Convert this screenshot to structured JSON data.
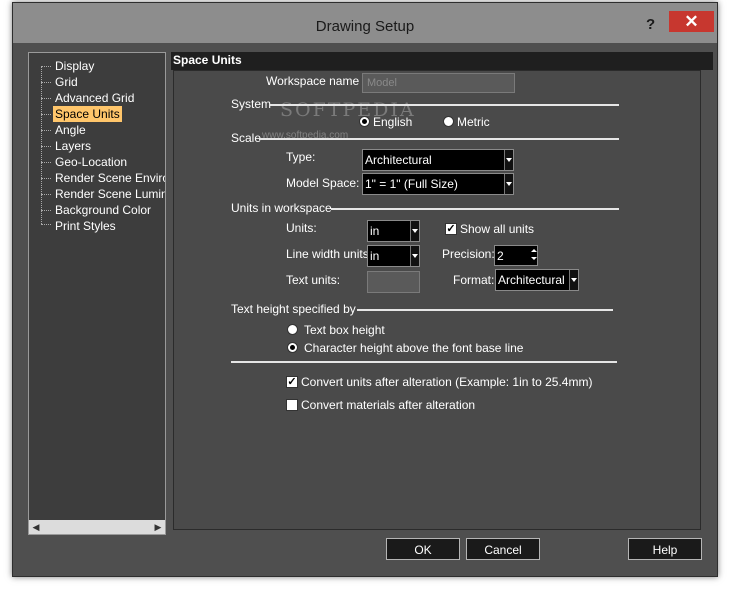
{
  "window": {
    "title": "Drawing Setup",
    "help_glyph": "?",
    "close_glyph": "✕"
  },
  "tree": {
    "items": [
      {
        "label": "Display",
        "selected": false
      },
      {
        "label": "Grid",
        "selected": false
      },
      {
        "label": "Advanced Grid",
        "selected": false
      },
      {
        "label": "Space Units",
        "selected": true
      },
      {
        "label": "Angle",
        "selected": false
      },
      {
        "label": "Layers",
        "selected": false
      },
      {
        "label": "Geo-Location",
        "selected": false
      },
      {
        "label": "Render Scene Environ",
        "selected": false
      },
      {
        "label": "Render Scene Lumina",
        "selected": false
      },
      {
        "label": "Background Color",
        "selected": false
      },
      {
        "label": "Print Styles",
        "selected": false
      }
    ]
  },
  "panel": {
    "header": "Space Units",
    "watermark": "SOFTPEDIA",
    "watermark_url": "www.softpedia.com",
    "workspace_name": {
      "label": "Workspace name",
      "value": "Model"
    },
    "system": {
      "label": "System",
      "english": "English",
      "metric": "Metric",
      "selected": "English"
    },
    "scale": {
      "label": "Scale",
      "type_label": "Type:",
      "type_value": "Architectural",
      "model_space_label": "Model Space:",
      "model_space_value": "1\" = 1\" (Full Size)"
    },
    "units_in_workspace": {
      "label": "Units in workspace",
      "units_label": "Units:",
      "units_value": "in",
      "line_width_label": "Line width units:",
      "line_width_value": "in",
      "text_units_label": "Text units:",
      "text_units_value": "",
      "show_all_label": "Show all units",
      "show_all_checked": true,
      "precision_label": "Precision:",
      "precision_value": "2",
      "format_label": "Format:",
      "format_value": "Architectural"
    },
    "text_height": {
      "label": "Text height specified by",
      "option1": "Text box height",
      "option2": "Character height above the font base line",
      "selected": "Character height above the font base line"
    },
    "convert_units": {
      "label": "Convert units after alteration (Example: 1in to 25.4mm)",
      "checked": true
    },
    "convert_materials": {
      "label": "Convert materials after alteration",
      "checked": false
    }
  },
  "buttons": {
    "ok": "OK",
    "cancel": "Cancel",
    "help": "Help"
  },
  "colors": {
    "selection": "#ffc66b",
    "close": "#c7372f"
  }
}
